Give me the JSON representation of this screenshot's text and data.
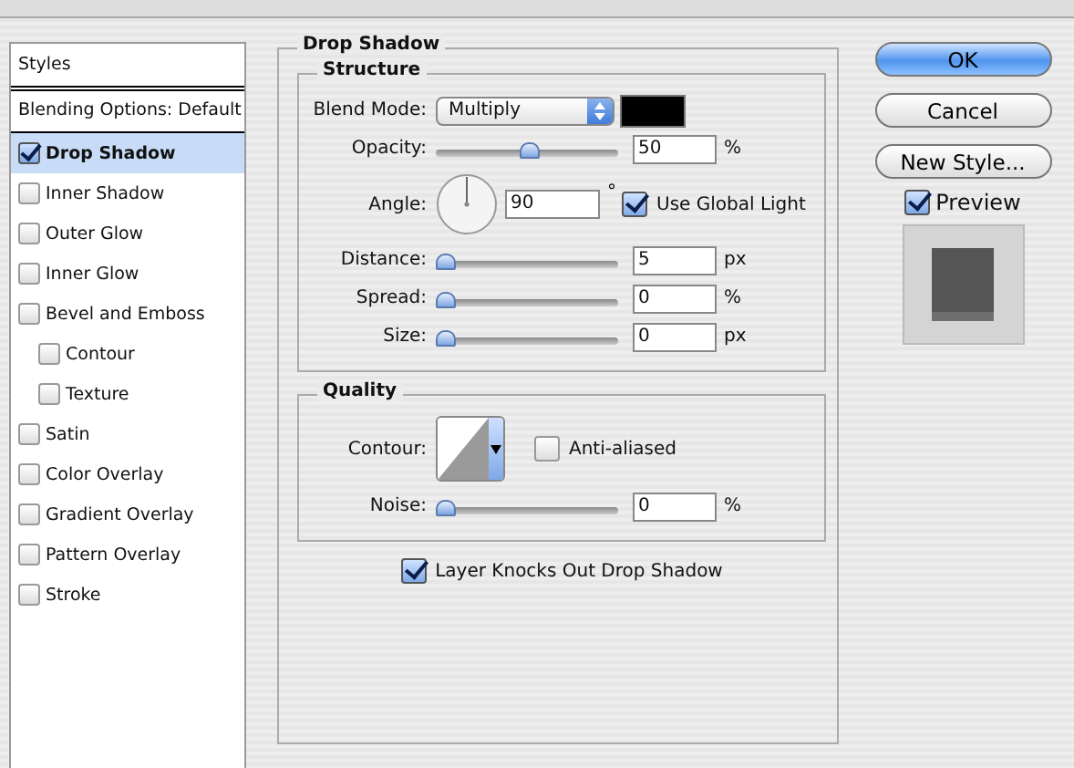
{
  "sidebar": {
    "header": "Styles",
    "blending_options": {
      "label": "Blending Options: Default",
      "selected": false
    },
    "items": [
      {
        "label": "Drop Shadow",
        "checked": true,
        "selected": true
      },
      {
        "label": "Inner Shadow",
        "checked": false,
        "selected": false
      },
      {
        "label": "Outer Glow",
        "checked": false,
        "selected": false
      },
      {
        "label": "Inner Glow",
        "checked": false,
        "selected": false
      },
      {
        "label": "Bevel and Emboss",
        "checked": false,
        "selected": false,
        "children": [
          {
            "label": "Contour",
            "checked": false,
            "selected": false
          },
          {
            "label": "Texture",
            "checked": false,
            "selected": false
          }
        ]
      },
      {
        "label": "Satin",
        "checked": false,
        "selected": false
      },
      {
        "label": "Color Overlay",
        "checked": false,
        "selected": false
      },
      {
        "label": "Gradient Overlay",
        "checked": false,
        "selected": false
      },
      {
        "label": "Pattern Overlay",
        "checked": false,
        "selected": false
      },
      {
        "label": "Stroke",
        "checked": false,
        "selected": false
      }
    ]
  },
  "panel": {
    "title": "Drop Shadow",
    "structure": {
      "title": "Structure",
      "blend_mode": {
        "label": "Blend Mode:",
        "value": "Multiply"
      },
      "rows": [
        {
          "kind": "slider",
          "label": "Opacity:",
          "value": "50",
          "unit": "%",
          "level": 0.5
        },
        {
          "kind": "angle",
          "label": "Angle:",
          "value": "90",
          "unit": "°",
          "global_light": {
            "label": "Use Global Light",
            "checked": true
          }
        },
        {
          "kind": "slider",
          "label": "Distance:",
          "value": "5",
          "unit": "px",
          "level": 0
        },
        {
          "kind": "slider",
          "label": "Spread:",
          "value": "0",
          "unit": "%",
          "level": 0
        },
        {
          "kind": "slider",
          "label": "Size:",
          "value": "0",
          "unit": "px",
          "level": 0
        }
      ]
    },
    "quality": {
      "title": "Quality",
      "contour": {
        "label": "Contour:",
        "anti_aliased": {
          "label": "Anti-aliased",
          "checked": false
        }
      },
      "noise": {
        "label": "Noise:",
        "value": "0",
        "unit": "%",
        "level": 0
      }
    },
    "knockout": {
      "label": "Layer Knocks Out Drop Shadow",
      "checked": true
    }
  },
  "buttons": [
    {
      "label": "OK",
      "default": true
    },
    {
      "label": "Cancel",
      "default": false
    },
    {
      "label": "New Style...",
      "default": false
    }
  ],
  "preview": {
    "label": "Preview",
    "checked": true
  }
}
